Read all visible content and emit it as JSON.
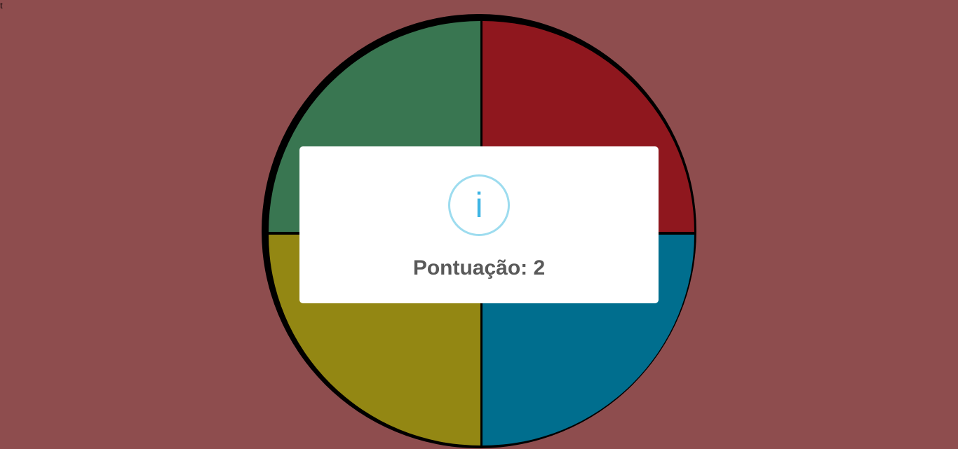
{
  "corner_text": "t",
  "board": {
    "quadrants": [
      {
        "name": "green",
        "color": "#397651"
      },
      {
        "name": "red",
        "color": "#8f171e"
      },
      {
        "name": "yellow",
        "color": "#938713"
      },
      {
        "name": "blue",
        "color": "#006e8e"
      }
    ],
    "border_color": "#000000"
  },
  "modal": {
    "icon": "info-icon",
    "icon_glyph": "i",
    "title": "Pontuação: 2"
  }
}
